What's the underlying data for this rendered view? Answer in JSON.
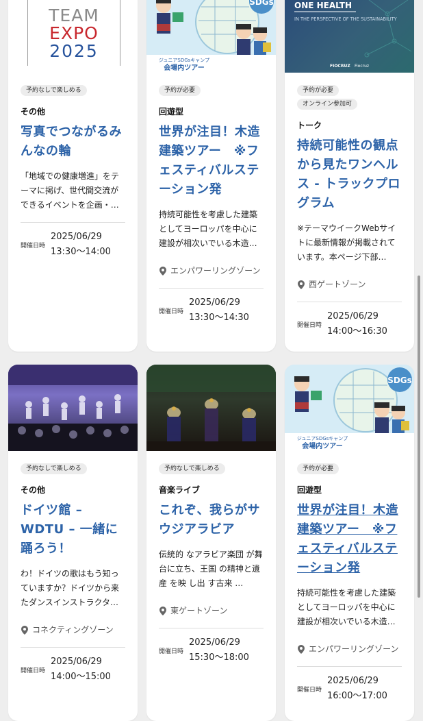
{
  "cards": [
    {
      "image": "team-expo-2025-logo",
      "logo": {
        "line1": "TEAM",
        "line2": "EXPO",
        "line3": "2025"
      },
      "tags": [
        "予約なしで楽しめる"
      ],
      "category": "その他",
      "title": "写真でつながるみんなの輪",
      "description": "「地域での健康増進」をテーマに掲げ、世代間交流ができるイベントを企画・…",
      "location": "",
      "date_label": "開催日時",
      "date": "2025/06/29",
      "time": "13:30～14:00"
    },
    {
      "image": "junior-sdgs-camp-tour",
      "tags": [
        "予約が必要"
      ],
      "category": "回遊型",
      "title": "世界が注目！木造建築ツアー　※フェスティバルステーション発",
      "description": "持続可能性を考慮した建築としてヨーロッパを中心に建設が相次いでいる木造…",
      "location": "エンパワーリングゾーン",
      "date_label": "開催日時",
      "date": "2025/06/29",
      "time": "13:30～14:30"
    },
    {
      "image": "one-health-banner",
      "banner": {
        "title": "ONE HEALTH",
        "subtitle": "IN THE PERSPECTIVE OF THE SUSTAINABILITY",
        "org1": "FIOCRUZ",
        "org2": "Fiocruz"
      },
      "tags": [
        "予約が必要",
        "オンライン参加可"
      ],
      "category": "トーク",
      "title": "持続可能性の観点から見たワンヘルス - トラックプログラム",
      "description": "※テーマウイークWebサイトに最新情報が掲載されています。本ページ下部…",
      "location": "西ゲートゾーン",
      "date_label": "開催日時",
      "date": "2025/06/29",
      "time": "14:00～16:30"
    },
    {
      "image": "dance-performance-photo",
      "tags": [
        "予約なしで楽しめる"
      ],
      "category": "その他",
      "title": "ドイツ館 – WDTU – 一緒に踊ろう！",
      "description": "わ！ドイツの歌はもう知っていますか？ドイツから来たダンスインストラクタ…",
      "location": "コネクティングゾーン",
      "date_label": "開催日時",
      "date": "2025/06/29",
      "time": "14:00～15:00"
    },
    {
      "image": "saudi-band-photo",
      "tags": [
        "予約なしで楽しめる"
      ],
      "category": "音楽ライブ",
      "title": "これぞ、我らがサウジアラビア",
      "description": "伝統的 なアラビア楽団 が舞台に立ち、王国 の精神と遺産 を映 し出 す古来 …",
      "location": "東ゲートゾーン",
      "date_label": "開催日時",
      "date": "2025/06/29",
      "time": "15:30～18:00"
    },
    {
      "image": "junior-sdgs-camp-tour",
      "tags": [
        "予約が必要"
      ],
      "category": "回遊型",
      "title": "世界が注目！木造建築ツアー　※フェスティバルステーション発",
      "description": "持続可能性を考慮した建築としてヨーロッパを中心に建設が相次いでいる木造…",
      "location": "エンパワーリングゾーン",
      "date_label": "開催日時",
      "date": "2025/06/29",
      "time": "16:00～17:00"
    }
  ],
  "sdgs_art": {
    "badge": "SDGs",
    "caption_line1": "ジュニアSDGsキャンプ",
    "caption_line2": "会場内ツアー"
  },
  "colors": {
    "title_blue": "#2d63a8",
    "tag_bg": "#ececec",
    "page_bg": "#eeeeee"
  }
}
